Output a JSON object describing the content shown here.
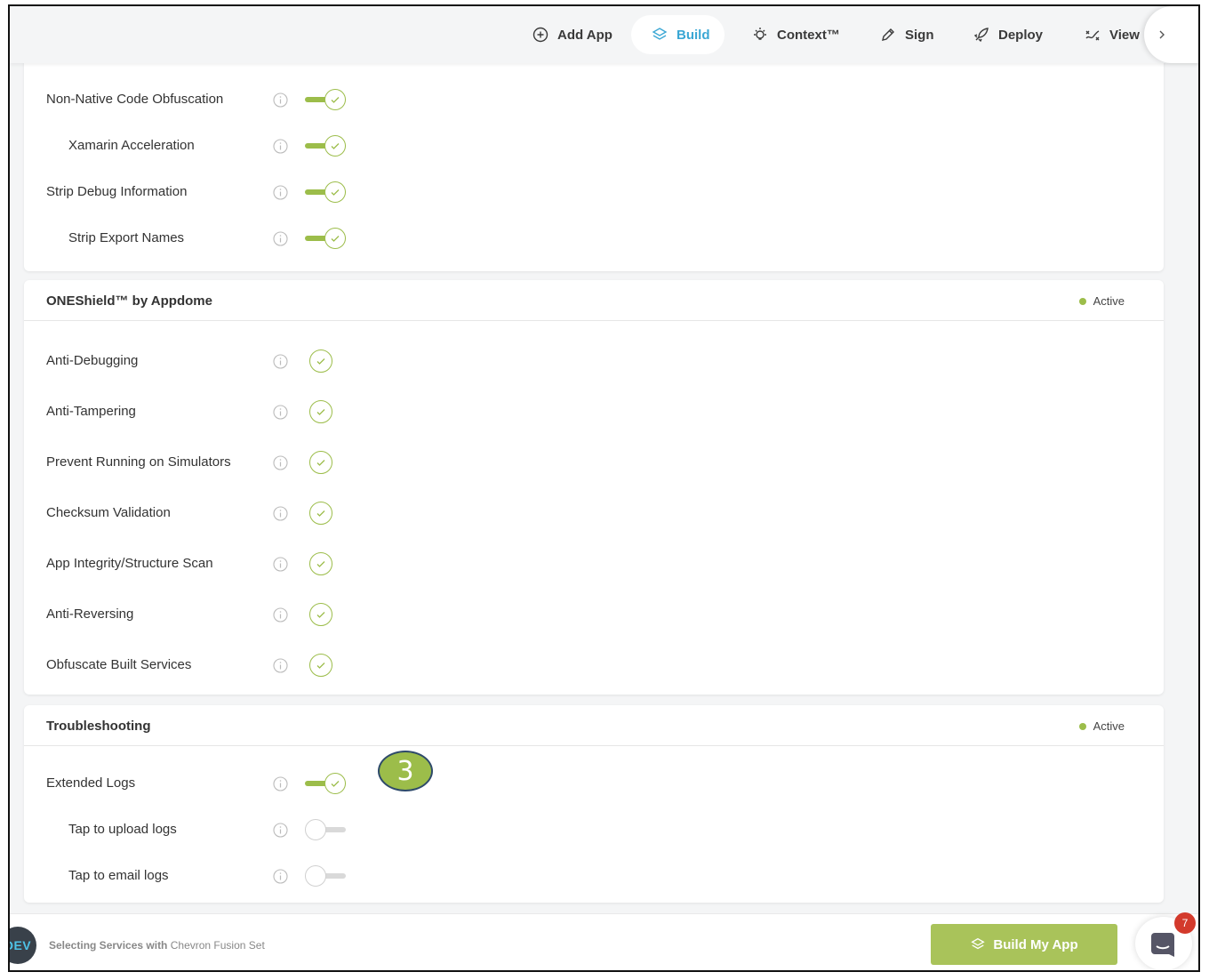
{
  "nav": {
    "items": [
      {
        "label": "Add App",
        "icon": "plus-circle-icon",
        "active": false
      },
      {
        "label": "Build",
        "icon": "layers-icon",
        "active": true
      },
      {
        "label": "Context™",
        "icon": "lightbulb-icon",
        "active": false
      },
      {
        "label": "Sign",
        "icon": "pen-icon",
        "active": false
      },
      {
        "label": "Deploy",
        "icon": "rocket-icon",
        "active": false
      },
      {
        "label": "View",
        "icon": "route-icon",
        "active": false
      }
    ],
    "more_icon": "chevron-right-icon"
  },
  "obfuscation": {
    "rows": [
      {
        "label": "Non-Native Code Obfuscation",
        "state": "on"
      },
      {
        "label": "Xamarin Acceleration",
        "state": "on"
      },
      {
        "label": "Strip Debug Information",
        "state": "on"
      },
      {
        "label": "Strip Export Names",
        "state": "on"
      }
    ]
  },
  "oneshield": {
    "title": "ONEShield™ by Appdome",
    "status": "Active",
    "rows": [
      {
        "label": "Anti-Debugging"
      },
      {
        "label": "Anti-Tampering"
      },
      {
        "label": "Prevent Running on Simulators"
      },
      {
        "label": "Checksum Validation"
      },
      {
        "label": "App Integrity/Structure Scan"
      },
      {
        "label": "Anti-Reversing"
      },
      {
        "label": "Obfuscate Built Services"
      }
    ]
  },
  "troubleshooting": {
    "title": "Troubleshooting",
    "status": "Active",
    "rows": [
      {
        "label": "Extended Logs",
        "state": "on"
      },
      {
        "label": "Tap to upload logs",
        "state": "off"
      },
      {
        "label": "Tap to email logs",
        "state": "off"
      }
    ]
  },
  "annotation": {
    "step": "3"
  },
  "footer": {
    "env_badge": "DEV",
    "text_prefix": "Selecting Services with",
    "text_set": "Chevron Fusion Set",
    "build_label": "Build My App",
    "chat_count": "7"
  },
  "colors": {
    "accent_green": "#9cbd4a",
    "accent_blue": "#3aa7d4",
    "button_green": "#a9c35a",
    "notification_red": "#d33a2c"
  }
}
